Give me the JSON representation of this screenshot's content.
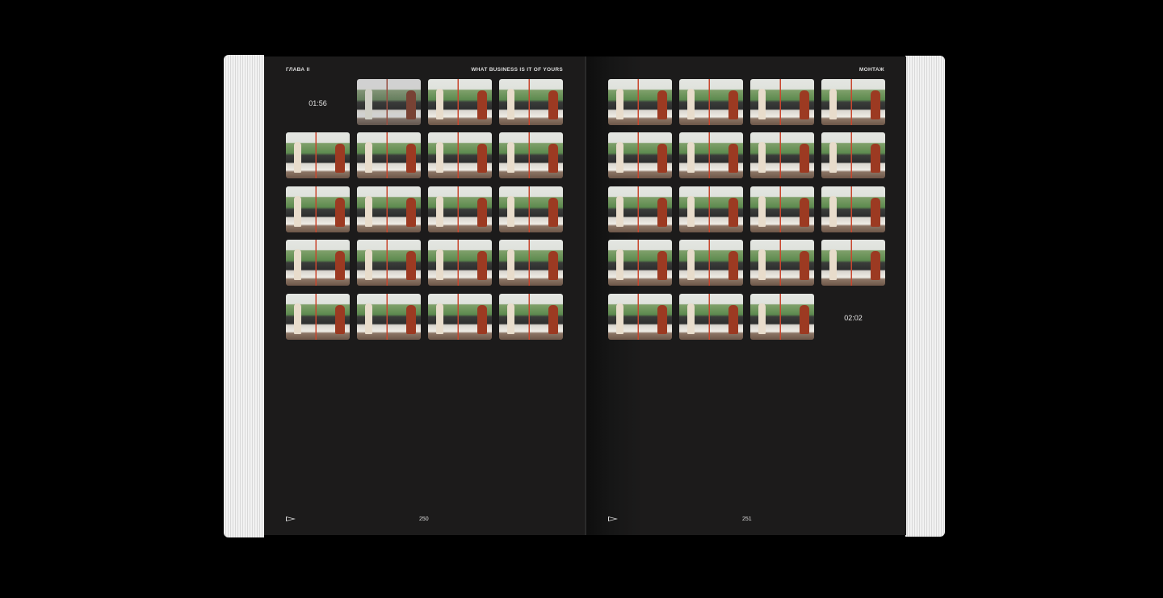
{
  "left_page": {
    "chapter": "ГЛАВА II",
    "title": "WHAT BUSINESS IS IT OF YOURS",
    "start_timecode": "01:56",
    "page_number": "250",
    "frame_count": 19
  },
  "right_page": {
    "section": "МОНТАЖ",
    "end_timecode": "02:02",
    "page_number": "251",
    "frame_count": 19
  }
}
